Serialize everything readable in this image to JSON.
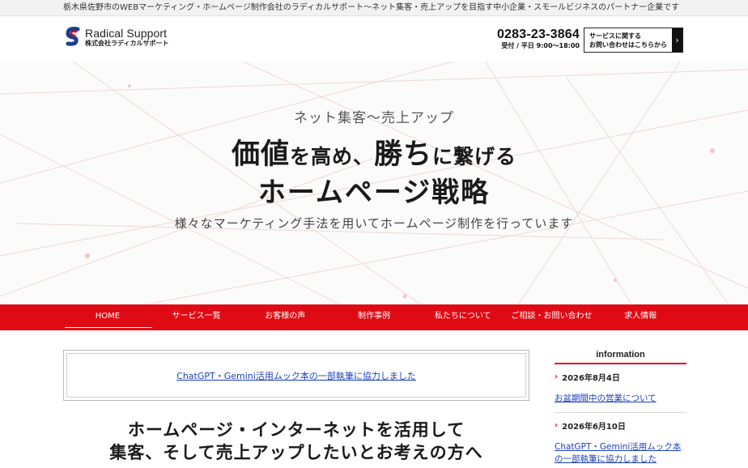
{
  "topbar": {
    "text": "栃木県佐野市のWEBマーケティング・ホームページ制作会社のラディカルサポート〜ネット集客・売上アップを目指す中小企業・スモールビジネスのパートナー企業です"
  },
  "header": {
    "logo_en": "Radical Support",
    "logo_ja": "株式会社ラディカルサポート",
    "phone": "0283-23-3864",
    "hours": "受付 / 平日 9:00〜18:00",
    "contact_line1": "サービスに関する",
    "contact_line2": "お問い合わせはこちらから",
    "contact_arrow": "›"
  },
  "hero": {
    "subtitle": "ネット集客〜売上アップ",
    "title_part1": "価値",
    "title_part2": "を高め、",
    "title_part3": "勝ち",
    "title_part4": "に繋げる",
    "title_line2": "ホームページ戦略",
    "description": "様々なマーケティング手法を用いてホームページ制作を行っています"
  },
  "nav": {
    "items": [
      {
        "label": "HOME"
      },
      {
        "label": "サービス一覧"
      },
      {
        "label": "お客様の声"
      },
      {
        "label": "制作事例"
      },
      {
        "label": "私たちについて"
      },
      {
        "label": "ご相談・お問い合わせ"
      },
      {
        "label": "求人情報"
      }
    ]
  },
  "news": {
    "link": "ChatGPT・Gemini活用ムック本の一部執筆に協力しました"
  },
  "catch": {
    "line1": "ホームページ・インターネットを活用して",
    "line2": "集客、そして売上アップしたいとお考えの方へ"
  },
  "sidebar": {
    "title": "information",
    "entries": [
      {
        "date": "2026年8月4日",
        "link": "お盆期間中の営業について"
      },
      {
        "date": "2026年6月10日",
        "link": "ChatGPT・Gemini活用ムック本の一部執筆に協力しました"
      }
    ]
  },
  "colors": {
    "accent": "#e00a14",
    "link": "#1a3fbf",
    "logo_blue": "#1b3d8f"
  },
  "icons": {
    "chevron": "›",
    "logo": "radical-support-logo-icon"
  }
}
